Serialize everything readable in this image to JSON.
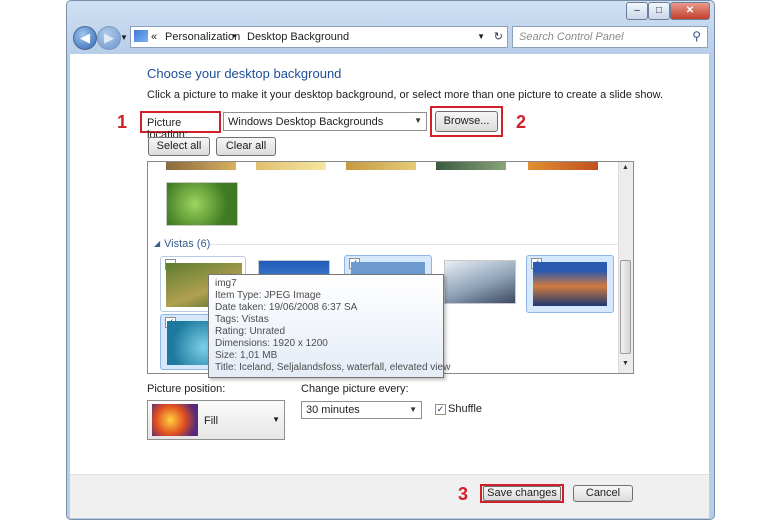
{
  "address": {
    "back_icon": "arrow-left-icon",
    "crumb_root": "«",
    "crumb_1": "Personalization",
    "sep": "▸",
    "crumb_2": "Desktop Background"
  },
  "search": {
    "placeholder": "Search Control Panel"
  },
  "heading": "Choose your desktop background",
  "description": "Click a picture to make it your desktop background, or select more than one picture to create a slide show.",
  "picture_location": {
    "label": "Picture location:",
    "value": "Windows Desktop Backgrounds",
    "browse": "Browse..."
  },
  "buttons": {
    "select_all": "Select all",
    "clear_all": "Clear all",
    "save": "Save changes",
    "cancel": "Cancel"
  },
  "group": {
    "name": "Vistas (6)"
  },
  "tooltip": {
    "lines": [
      "img7",
      "Item Type: JPEG Image",
      "Date taken: 19/06/2008 6:37 SA",
      "Tags: Vistas",
      "Rating: Unrated",
      "Dimensions: 1920 x 1200",
      "Size: 1,01 MB",
      "Title: Iceland, Seljalandsfoss, waterfall, elevated view"
    ]
  },
  "position": {
    "label": "Picture position:",
    "value": "Fill"
  },
  "interval": {
    "label": "Change picture every:",
    "value": "30 minutes"
  },
  "shuffle": {
    "label": "Shuffle",
    "checked": true
  },
  "annotations": {
    "one": "1",
    "two": "2",
    "three": "3"
  },
  "colors": {
    "annotation_red": "#d0202a",
    "heading_blue": "#1e4e9a"
  }
}
